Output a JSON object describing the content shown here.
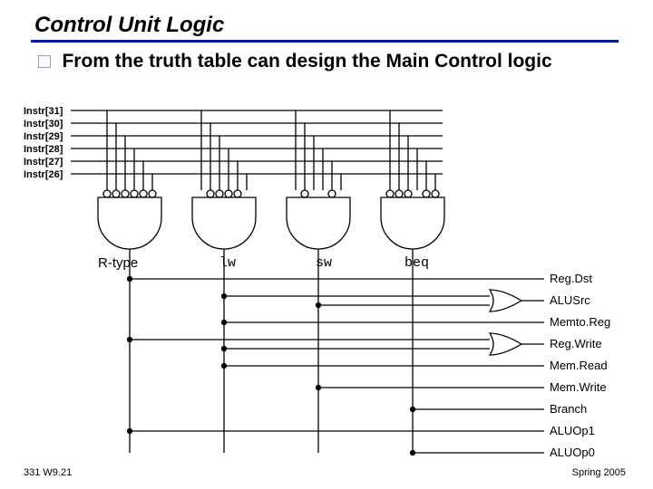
{
  "title": "Control Unit Logic",
  "bullet": "From the truth table can design the Main Control logic",
  "inputs": [
    "Instr[31]",
    "Instr[30]",
    "Instr[29]",
    "Instr[28]",
    "Instr[27]",
    "Instr[26]"
  ],
  "gates": {
    "rtype": "R-type",
    "lw": "lw",
    "sw": "sw",
    "beq": "beq"
  },
  "outputs": [
    "Reg.Dst",
    "ALUSrc",
    "Memto.Reg",
    "Reg.Write",
    "Mem.Read",
    "Mem.Write",
    "Branch",
    "ALUOp1",
    "ALUOp0"
  ],
  "footer": {
    "left": "331 W9.21",
    "right": "Spring 2005"
  }
}
